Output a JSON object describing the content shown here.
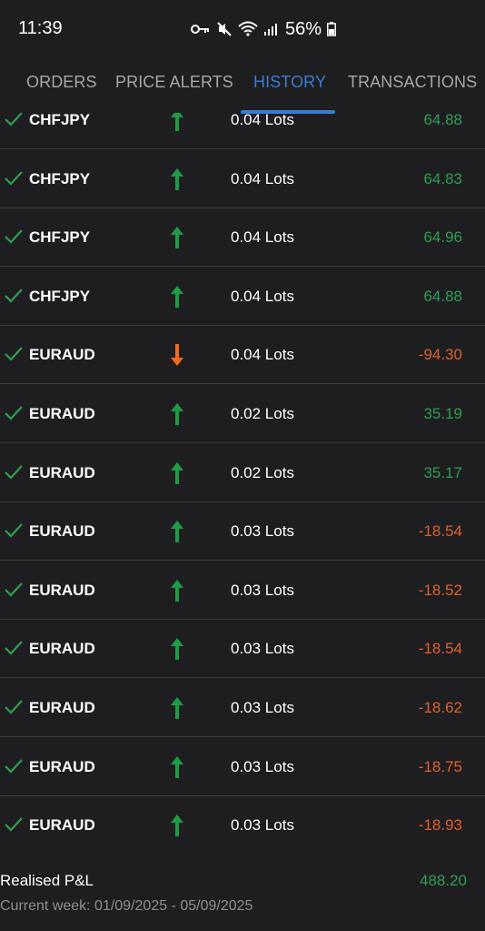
{
  "status_bar": {
    "time": "11:39",
    "battery": "56%",
    "icons": [
      "vpn-key-icon",
      "mute-icon",
      "wifi-icon",
      "signal-icon",
      "battery-icon"
    ]
  },
  "tabs": [
    {
      "label": "ORDERS",
      "active": false
    },
    {
      "label": "PRICE ALERTS",
      "active": false
    },
    {
      "label": "HISTORY",
      "active": true
    },
    {
      "label": "TRANSACTIONS",
      "active": false
    }
  ],
  "colors": {
    "accent": "#3a7bd5",
    "positive": "#2e9e4f",
    "negative": "#e0602c",
    "buy_arrow": "#1f9a48",
    "sell_arrow": "#f26b1d",
    "check": "#2e9e4f"
  },
  "history": [
    {
      "symbol": "CHFJPY",
      "direction": "up",
      "volume": "0.04 Lots",
      "profit": "64.88",
      "positive": true
    },
    {
      "symbol": "CHFJPY",
      "direction": "up",
      "volume": "0.04 Lots",
      "profit": "64.83",
      "positive": true
    },
    {
      "symbol": "CHFJPY",
      "direction": "up",
      "volume": "0.04 Lots",
      "profit": "64.96",
      "positive": true
    },
    {
      "symbol": "CHFJPY",
      "direction": "up",
      "volume": "0.04 Lots",
      "profit": "64.88",
      "positive": true
    },
    {
      "symbol": "EURAUD",
      "direction": "down",
      "volume": "0.04 Lots",
      "profit": "-94.30",
      "positive": false
    },
    {
      "symbol": "EURAUD",
      "direction": "up",
      "volume": "0.02 Lots",
      "profit": "35.19",
      "positive": true
    },
    {
      "symbol": "EURAUD",
      "direction": "up",
      "volume": "0.02 Lots",
      "profit": "35.17",
      "positive": true
    },
    {
      "symbol": "EURAUD",
      "direction": "up",
      "volume": "0.03 Lots",
      "profit": "-18.54",
      "positive": false
    },
    {
      "symbol": "EURAUD",
      "direction": "up",
      "volume": "0.03 Lots",
      "profit": "-18.52",
      "positive": false
    },
    {
      "symbol": "EURAUD",
      "direction": "up",
      "volume": "0.03 Lots",
      "profit": "-18.54",
      "positive": false
    },
    {
      "symbol": "EURAUD",
      "direction": "up",
      "volume": "0.03 Lots",
      "profit": "-18.62",
      "positive": false
    },
    {
      "symbol": "EURAUD",
      "direction": "up",
      "volume": "0.03 Lots",
      "profit": "-18.75",
      "positive": false
    },
    {
      "symbol": "EURAUD",
      "direction": "up",
      "volume": "0.03 Lots",
      "profit": "-18.93",
      "positive": false
    }
  ],
  "footer": {
    "realised_label": "Realised P&L",
    "realised_value": "488.20",
    "period": "Current week: 01/09/2025 - 05/09/2025"
  }
}
